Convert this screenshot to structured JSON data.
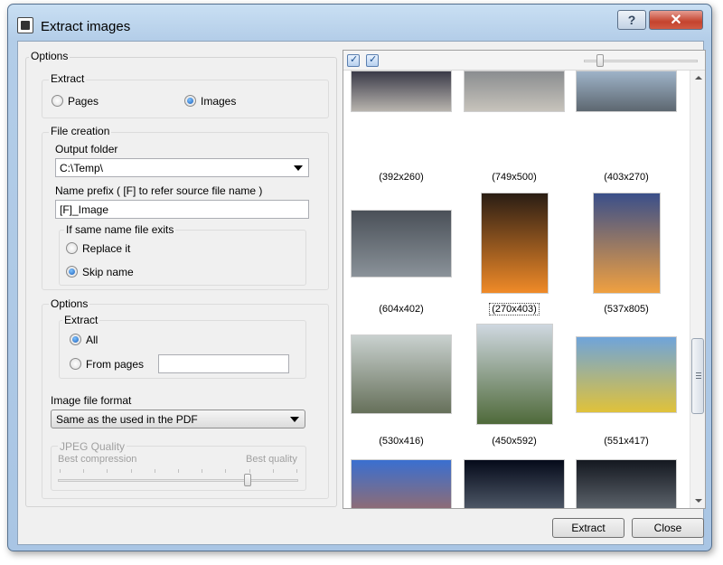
{
  "window": {
    "title": "Extract images",
    "help_label": "?",
    "close_label": "✕"
  },
  "options": {
    "group_label": "Options",
    "extract": {
      "label": "Extract",
      "pages": "Pages",
      "images": "Images",
      "selected": "Images"
    },
    "file_creation": {
      "label": "File creation",
      "output_folder_label": "Output folder",
      "output_folder_value": "C:\\Temp\\",
      "name_prefix_label": "Name prefix ( [F] to refer source file name )",
      "name_prefix_value": "[F]_Image",
      "same_name": {
        "label": "If same name file exits",
        "replace": "Replace it",
        "skip": "Skip name",
        "selected": "Skip name"
      }
    },
    "sub_options": {
      "label": "Options",
      "extract_label": "Extract",
      "all": "All",
      "from_pages": "From pages",
      "from_pages_value": "",
      "selected": "All"
    },
    "image_format": {
      "label": "Image file format",
      "value": "Same as the used in the PDF"
    },
    "jpeg": {
      "label": "JPEG Quality",
      "min_label": "Best compression",
      "max_label": "Best quality",
      "level": 0.8
    }
  },
  "thumbnail_zoom": 0.12,
  "images": [
    {
      "dim": "(392x260)",
      "colors": [
        "#3a3a48",
        "#b8b4ae"
      ]
    },
    {
      "dim": "(749x500)",
      "colors": [
        "#8a8d90",
        "#c7c3bb"
      ]
    },
    {
      "dim": "(403x270)",
      "colors": [
        "#9eb3c8",
        "#5d6770"
      ]
    },
    {
      "dim": "(604x402)",
      "colors": [
        "#4a5058",
        "#8a9299"
      ]
    },
    {
      "dim": "(270x403)",
      "colors": [
        "#2a1d14",
        "#f08a28"
      ],
      "selected": true
    },
    {
      "dim": "(537x805)",
      "colors": [
        "#3a4f8a",
        "#f0a040"
      ]
    },
    {
      "dim": "(530x416)",
      "colors": [
        "#c9d1cf",
        "#66705a"
      ]
    },
    {
      "dim": "(450x592)",
      "colors": [
        "#cfd8e0",
        "#4f6a3a"
      ]
    },
    {
      "dim": "(551x417)",
      "colors": [
        "#6fa4da",
        "#e0c23a"
      ]
    },
    {
      "dim": "",
      "colors": [
        "#3a6fd0",
        "#d66a28"
      ]
    },
    {
      "dim": "",
      "colors": [
        "#050a1a",
        "#8c9aa8"
      ]
    },
    {
      "dim": "",
      "colors": [
        "#141820",
        "#9aa3ab"
      ]
    }
  ],
  "buttons": {
    "extract": "Extract",
    "close": "Close"
  }
}
